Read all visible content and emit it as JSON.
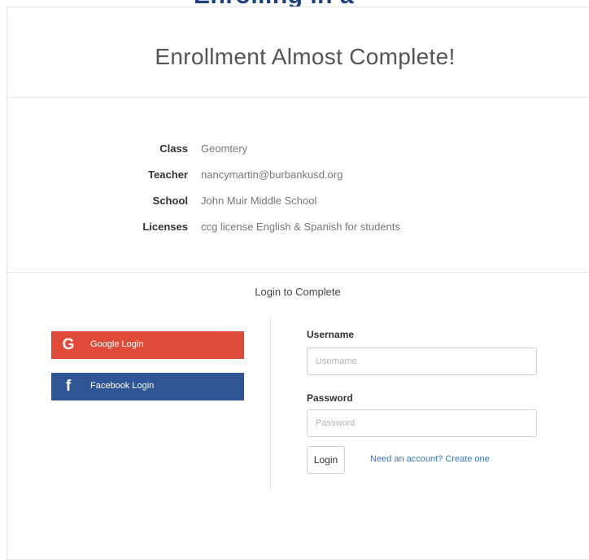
{
  "header_fragment": "Enrolling in a",
  "page": {
    "title": "Enrollment Almost Complete!"
  },
  "enrollment_info": [
    {
      "key": "Class",
      "value": "Geomtery"
    },
    {
      "key": "Teacher",
      "value": "nancymartin@burbankusd.org"
    },
    {
      "key": "School",
      "value": "John Muir Middle School"
    },
    {
      "key": "Licenses",
      "value": "ccg license English & Spanish for students"
    }
  ],
  "login": {
    "heading": "Login to Complete",
    "google": {
      "label": "Google Login",
      "icon": "google-icon",
      "glyph": "G",
      "color": "#e04a39"
    },
    "facebook": {
      "label": "Facebook Login",
      "icon": "facebook-icon",
      "glyph": "f",
      "color": "#2f5597"
    },
    "username": {
      "label": "Username",
      "placeholder": "Username",
      "value": ""
    },
    "password": {
      "label": "Password",
      "placeholder": "Password",
      "value": ""
    },
    "submit_label": "Login",
    "create_account_link": "Need an account? Create one",
    "link_color": "#3a77b8"
  }
}
